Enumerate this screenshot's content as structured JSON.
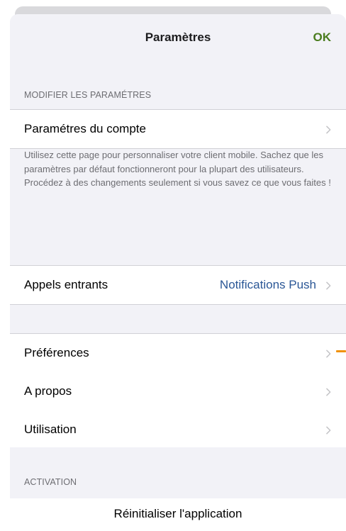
{
  "nav": {
    "title": "Paramètres",
    "done_label": "OK"
  },
  "section_modify": {
    "header": "MODIFIER LES PARAMÉTRES",
    "rows": [
      {
        "label": "Paramétres du compte",
        "icon": "chevron-right-icon"
      }
    ],
    "footer": "Utilisez cette page pour personnaliser votre client mobile. Sachez que les paramètres par défaut fonctionneront pour la plupart des utilisateurs. Procédez à des changements seulement si vous savez ce que vous faites !"
  },
  "section_calls": {
    "rows": [
      {
        "label": "Appels entrants",
        "value": "Notifications Push",
        "icon": "chevron-right-icon"
      }
    ]
  },
  "section_general": {
    "rows": [
      {
        "label": "Préférences",
        "icon": "chevron-right-icon"
      },
      {
        "label": "A propos",
        "icon": "chevron-right-icon"
      },
      {
        "label": "Utilisation",
        "icon": "chevron-right-icon"
      }
    ]
  },
  "section_activation": {
    "header": "ACTIVATION",
    "reset_label": "Réinitialiser l'application"
  },
  "colors": {
    "accent_ok": "#4a7c1e",
    "value_blue": "#2b5796",
    "indicator_orange": "#f0920a",
    "grouped_background": "#f2f2f7"
  }
}
